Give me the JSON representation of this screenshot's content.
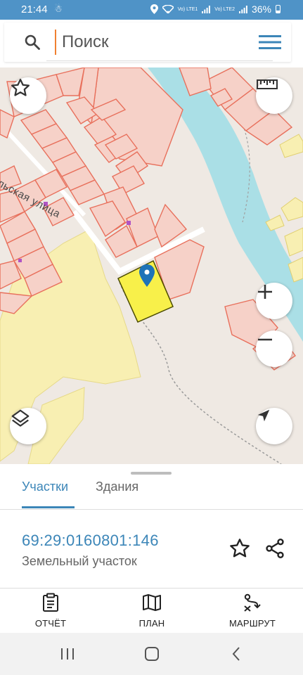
{
  "status_bar": {
    "time": "21:44",
    "left_icon": "notification-icon",
    "network_1": "Vo) LTE1",
    "network_2": "Vo) LTE2",
    "battery": "36%"
  },
  "search": {
    "placeholder": "Поиск"
  },
  "map": {
    "street_label": "ельская улица",
    "colors": {
      "background": "#efe9e3",
      "river": "#aadfe6",
      "parcel_fill": "#f6d1c8",
      "parcel_border": "#e8705c",
      "field_fill": "#f8efb2",
      "selected_parcel": "#f8f04a"
    }
  },
  "sheet": {
    "tabs": [
      {
        "label": "Участки",
        "active": true
      },
      {
        "label": "Здания",
        "active": false
      }
    ],
    "parcel": {
      "cadastral_number": "69:29:0160801:146",
      "type": "Земельный участок"
    }
  },
  "toolbar": {
    "report_label": "ОТЧЁТ",
    "plan_label": "ПЛАН",
    "route_label": "МАРШРУТ"
  },
  "accent_color": "#3c86b8"
}
